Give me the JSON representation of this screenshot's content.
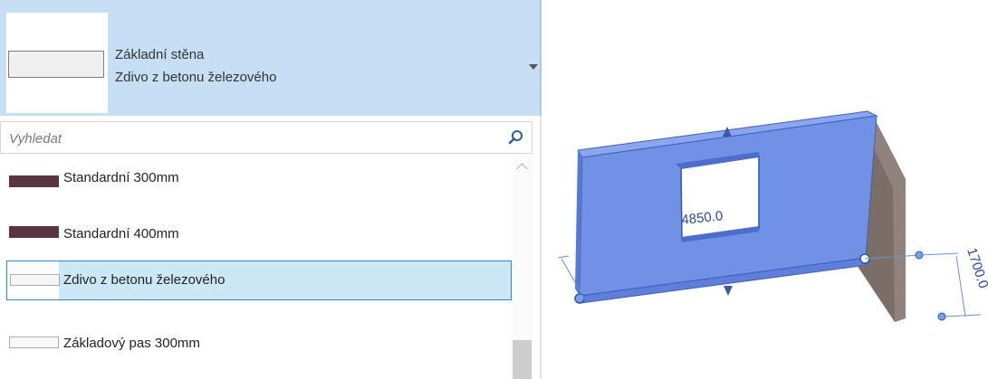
{
  "type_selector": {
    "family_name": "Základní stěna",
    "current_type": "Zdivo z betonu železového",
    "search_placeholder": "Vyhledat",
    "items": [
      {
        "label": "Standardní 300mm",
        "swatch_color": "#5a3441"
      },
      {
        "label": "Standardní 400mm",
        "swatch_color": "#5a3441"
      },
      {
        "label": "Zdivo z betonu železového",
        "swatch_color": "#f5f5f5",
        "selected": true
      },
      {
        "label": "Základový pas 300mm",
        "swatch_color": "#f8f8f8"
      }
    ]
  },
  "viewport": {
    "opening_dimension": "4850.0",
    "height_dimension": "1700.0",
    "selected_wall_color": "#6f92e6",
    "dimension_color": "#2a4a9a"
  },
  "icons": {
    "search": "search-icon",
    "dropdown": "chevron-down-icon"
  }
}
